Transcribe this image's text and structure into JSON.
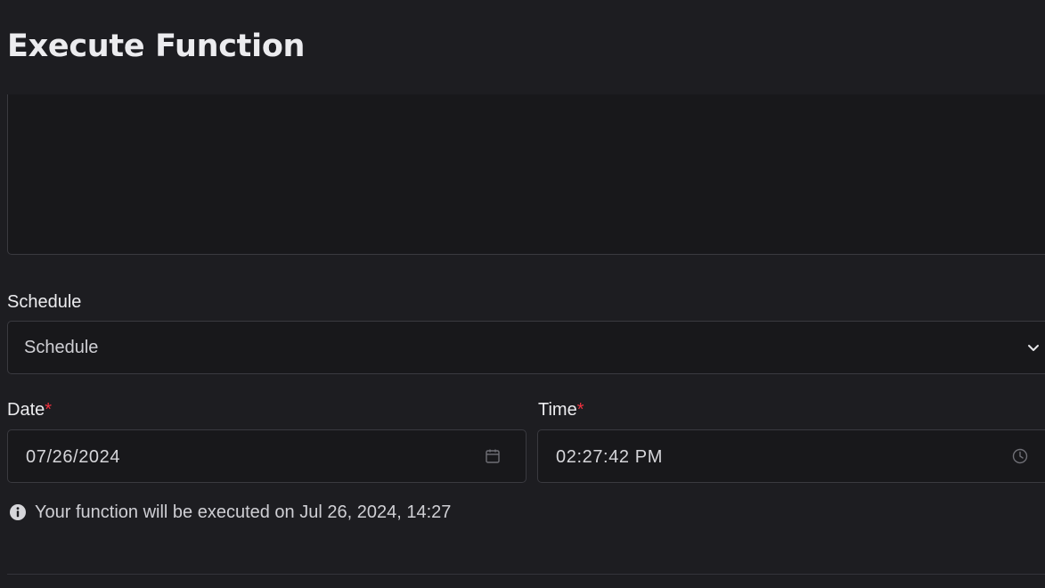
{
  "dialog": {
    "title": "Execute Function"
  },
  "form": {
    "schedule_label": "Schedule",
    "schedule_selected": "Schedule",
    "date_label": "Date",
    "date_required_mark": "*",
    "date_value": "07/26/2024",
    "time_label": "Time",
    "time_required_mark": "*",
    "time_value": "02:27:42 PM",
    "info_text": "Your function will be executed on Jul 26, 2024, 14:27"
  },
  "icons": {
    "select": "chevron-down-icon",
    "date": "calendar-icon",
    "time": "clock-icon",
    "info": "info-icon"
  },
  "colors": {
    "background": "#1d1d21",
    "input_background": "#18181b",
    "border": "#3a3a40",
    "required": "#f0313f",
    "text": "#ececef"
  }
}
